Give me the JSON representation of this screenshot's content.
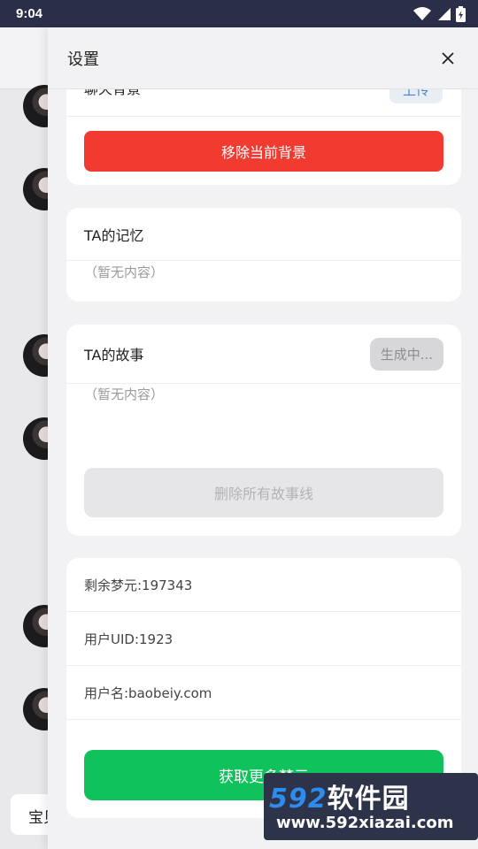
{
  "status_bar": {
    "time": "9:04"
  },
  "drawer": {
    "title": "设置",
    "background_card": {
      "partial_label": "聊天背景",
      "upload_label": "上传",
      "remove_button": "移除当前背景"
    },
    "memory_card": {
      "title": "TA的记忆",
      "empty_text": "（暂无内容）"
    },
    "story_card": {
      "title": "TA的故事",
      "status_chip": "生成中...",
      "empty_text": "（暂无内容）",
      "delete_button": "删除所有故事线"
    },
    "account_card": {
      "dream_coins": "剩余梦元:197343",
      "uid": "用户UID:1923",
      "username": "用户名:baobeiy.com",
      "get_more_button": "获取更多梦元"
    }
  },
  "background_page": {
    "input_text": "宝贝"
  },
  "watermark": {
    "main_num": "592",
    "main_text": "软件园",
    "sub": "www.592xiazai.com"
  },
  "colors": {
    "danger": "#f13a30",
    "success": "#10c25b",
    "status_bar": "#2b2e48"
  }
}
